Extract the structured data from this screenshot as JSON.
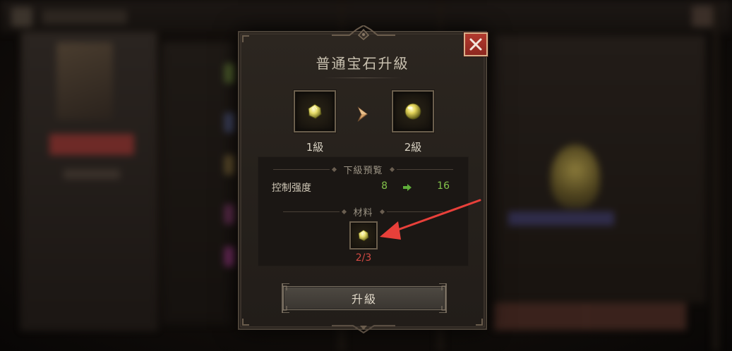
{
  "dialog": {
    "title": "普通宝石升級",
    "close_icon": "close-x-icon",
    "current_gem": {
      "icon": "yellow-gem-small-icon",
      "level_label": "1級"
    },
    "next_gem": {
      "icon": "yellow-gem-round-icon",
      "level_label": "2級"
    },
    "preview": {
      "header": "下級預覧",
      "stat": {
        "name": "控制强度",
        "from": "8",
        "to": "16"
      }
    },
    "material": {
      "header": "材料",
      "icon": "yellow-gem-small-icon",
      "count": "2/3"
    },
    "upgrade_button_label": "升級"
  },
  "colors": {
    "stat_value": "#82c24a",
    "insufficient_count": "#d34a44",
    "close_button": "#a8332a",
    "pointer_arrow": "#e8403a"
  }
}
